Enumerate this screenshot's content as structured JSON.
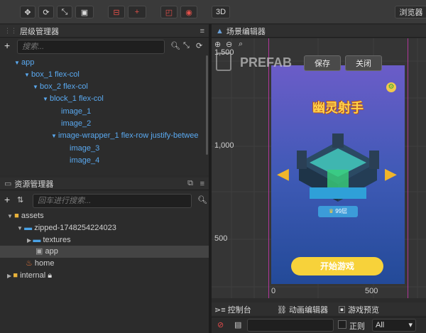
{
  "toolbar": {
    "btn_3d": "3D",
    "browser": "浏览器"
  },
  "hierarchy": {
    "title": "层级管理器",
    "search_placeholder": "搜索...",
    "nodes": [
      "app",
      "box_1 flex-col",
      "box_2 flex-col",
      "block_1 flex-col",
      "image_1",
      "image_2",
      "image-wrapper_1 flex-row justify-betwee",
      "image_3",
      "image_4"
    ]
  },
  "assets": {
    "title": "资源管理器",
    "search_placeholder": "回车进行搜索...",
    "items": [
      "assets",
      "zipped-1748254224023",
      "textures",
      "app",
      "home",
      "internal"
    ]
  },
  "scene": {
    "title": "场景编辑器",
    "prefab": "PREFAB",
    "save": "保存",
    "close": "关闭",
    "ruler": {
      "y_1500": "1,500",
      "y_1000": "1,000",
      "y_500": "500",
      "x_0": "0",
      "x_500": "500"
    },
    "game": {
      "title": "幽灵射手",
      "count": "99层",
      "start": "开始游戏"
    }
  },
  "bottom": {
    "console": "控制台",
    "anim": "动画编辑器",
    "preview": "游戏预览",
    "regex": "正则",
    "filter": "All"
  },
  "colors": {
    "tree_blue": "#5aa9f0",
    "canvas_border": "#b0379a",
    "start_btn": "#f7d23a"
  }
}
